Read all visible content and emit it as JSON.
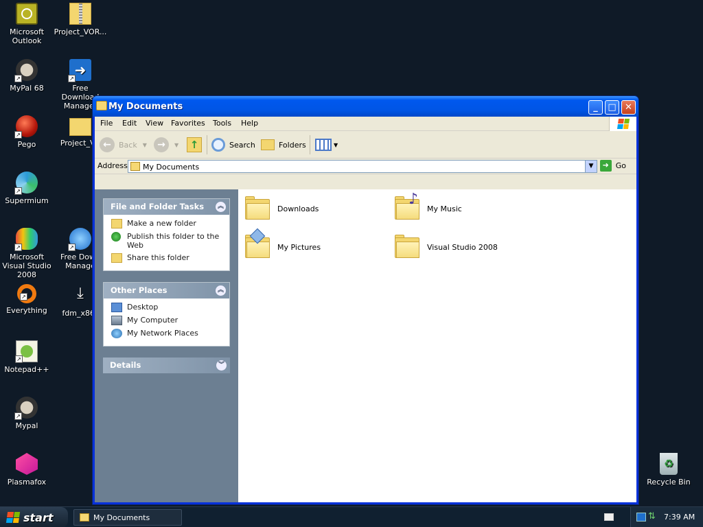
{
  "desktop": {
    "icons_left": [
      {
        "label": "Microsoft Outlook",
        "icon": "outlook-icon"
      },
      {
        "label": "MyPal 68",
        "icon": "mypal-icon"
      },
      {
        "label": "Pego",
        "icon": "pego-icon"
      },
      {
        "label": "Supermium",
        "icon": "supermium-icon"
      },
      {
        "label": "Microsoft Visual Studio 2008",
        "icon": "visual-studio-icon"
      },
      {
        "label": "Everything",
        "icon": "everything-icon"
      },
      {
        "label": "Notepad++",
        "icon": "notepad-plus-plus-icon"
      },
      {
        "label": "Mypal",
        "icon": "mypal-icon"
      },
      {
        "label": "Plasmafox",
        "icon": "plasmafox-icon"
      }
    ],
    "icons_col2": [
      {
        "label": "Project_VOR...",
        "icon": "zip-folder-icon"
      },
      {
        "label": "Free Download Manager",
        "icon": "free-download-manager-icon"
      },
      {
        "label": "Project_VC",
        "icon": "folder-icon"
      },
      {
        "label": "Free Down Manage",
        "icon": "free-download-manager-icon"
      },
      {
        "label": "fdm_x86_",
        "icon": "installer-icon"
      }
    ],
    "recycle_bin": {
      "label": "Recycle Bin",
      "icon": "recycle-bin-icon"
    }
  },
  "window": {
    "title": "My Documents",
    "menu": [
      "File",
      "Edit",
      "View",
      "Favorites",
      "Tools",
      "Help"
    ],
    "toolbar": {
      "back_label": "Back",
      "search_label": "Search",
      "folders_label": "Folders"
    },
    "address": {
      "label": "Address",
      "value": "My Documents",
      "go_label": "Go"
    },
    "tasks": {
      "file_folder": {
        "title": "File and Folder Tasks",
        "items": [
          "Make a new folder",
          "Publish this folder to the Web",
          "Share this folder"
        ]
      },
      "other_places": {
        "title": "Other Places",
        "items": [
          "Desktop",
          "My Computer",
          "My Network Places"
        ]
      },
      "details": {
        "title": "Details"
      }
    },
    "folders": [
      {
        "name": "Downloads",
        "icon": "folder-icon"
      },
      {
        "name": "My Music",
        "icon": "music-folder-icon"
      },
      {
        "name": "My Pictures",
        "icon": "pictures-folder-icon"
      },
      {
        "name": "Visual Studio 2008",
        "icon": "folder-icon"
      }
    ]
  },
  "taskbar": {
    "start_label": "start",
    "task_button": "My Documents",
    "clock": "7:39 AM"
  },
  "colors": {
    "desktop_bg": "#0f1a27",
    "title_blue": "#0055e5",
    "task_pane": "#6c7f92",
    "folder_yellow": "#f3d66f"
  }
}
